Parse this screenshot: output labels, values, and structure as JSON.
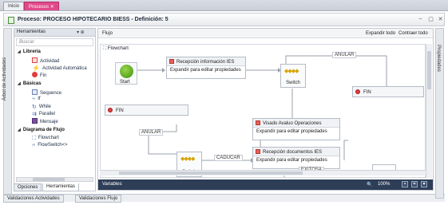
{
  "top_tabs": [
    {
      "label": "Inicio"
    },
    {
      "label": "Procesos"
    }
  ],
  "window": {
    "title": "Proceso: PROCESO HIPOTECARIO BIESS - Definición: 5",
    "min": "–",
    "max": "▢",
    "close": "✕"
  },
  "left_side_tab": "Árbol de Actividades",
  "right_side_tab": "Propiedades",
  "tool_panel": {
    "title": "Herramientas",
    "pin": "▾ ⊕",
    "search_placeholder": "Buscar",
    "categories": [
      {
        "label": "Librería",
        "items": [
          "Actividad",
          "Actividad Automática",
          "Fin"
        ]
      },
      {
        "label": "Básicas",
        "items": [
          "Sequence",
          "If",
          "While",
          "Parallel",
          "Mensaje"
        ]
      },
      {
        "label": "Diagrama de Flujo",
        "items": [
          "Flowchart",
          "FlowSwitch<>"
        ]
      }
    ]
  },
  "bottom_tabs_inner": [
    {
      "label": "Opciones"
    },
    {
      "label": "Herramientas"
    }
  ],
  "bottom_tabs_outer": [
    {
      "label": "Validaciones Actividades"
    },
    {
      "label": "Validaciones Flujo"
    }
  ],
  "designer": {
    "header": "Flujo",
    "expand_all": "Expandir todo",
    "collapse_all": "Contraer todo",
    "flowchart_label": "Flowchart",
    "start_label": "Start",
    "activities": {
      "recepcion_info": {
        "title": "Recepción información IES",
        "body": "Expandir para editar propiedades"
      },
      "visado": {
        "title": "Visado Avaluo Operaciones",
        "body": "Expandir para editar propiedades"
      },
      "recepcion_docs": {
        "title": "Recepción documentos IES",
        "body": "Expandir para editar propiedades"
      }
    },
    "switch_label": "Switch",
    "fin_label": "FIN",
    "conditions": {
      "anular": "ANULAR",
      "caducar": "CADUCAR",
      "exitosa": "EXITOSA"
    },
    "variables_label": "Variables",
    "zoom": "100%",
    "zoom_icon": "🔍"
  }
}
